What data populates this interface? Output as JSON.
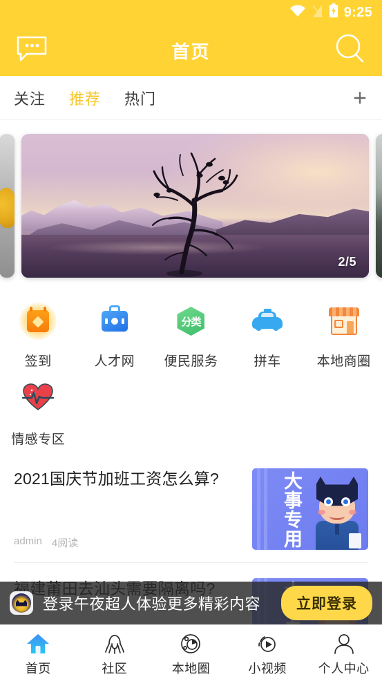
{
  "theme": {
    "brand_yellow": "#FFD333",
    "tab_active": "#F6C62B",
    "login_btn": "#FFD84A",
    "nav_active": "#2A9BF0"
  },
  "statusbar": {
    "time": "9:25",
    "icons": [
      "wifi-icon",
      "signal-off-icon",
      "battery-charging-icon"
    ]
  },
  "header": {
    "title": "首页",
    "left_icon": "chat-bubble-icon",
    "right_icon": "search-icon"
  },
  "tabs": {
    "items": [
      {
        "label": "关注",
        "active": false
      },
      {
        "label": "推荐",
        "active": true
      },
      {
        "label": "热门",
        "active": false
      }
    ],
    "add_label": "+",
    "add_icon": "plus-icon"
  },
  "carousel": {
    "indicator": "2/5",
    "slides": [
      {
        "name": "slide-prev",
        "art": "gray-gold-statue"
      },
      {
        "name": "slide-current",
        "art": "purple-mountain-lake-tree"
      },
      {
        "name": "slide-next",
        "art": "gray-green-landscape"
      }
    ]
  },
  "quick_links": {
    "row1": [
      {
        "label": "签到",
        "icon": "sign-in-calendar-icon"
      },
      {
        "label": "人才网",
        "icon": "briefcase-icon"
      },
      {
        "label": "便民服务",
        "icon": "category-hexagon-icon",
        "icon_text": "分类"
      },
      {
        "label": "拼车",
        "icon": "car-icon"
      },
      {
        "label": "本地商圈",
        "icon": "shop-icon"
      }
    ],
    "row2": [
      {
        "label": "情感专区",
        "icon": "heartbeat-icon"
      }
    ]
  },
  "articles": [
    {
      "title": "2021国庆节加班工资怎么算?",
      "author": "admin",
      "views": "4阅读",
      "thumb": {
        "overlay_text": "大事专用",
        "art": "blue-superhero-thumbnail"
      }
    },
    {
      "title": "福建莆田去汕头需要隔离吗?",
      "author": "",
      "views": "",
      "thumb": {
        "overlay_text": "大事专用",
        "art": "blue-superhero-thumbnail"
      }
    }
  ],
  "login_banner": {
    "text": "登录午夜超人体验更多精彩内容",
    "button_label": "立即登录",
    "avatar_icon": "app-logo-icon"
  },
  "bottom_nav": {
    "items": [
      {
        "label": "首页",
        "icon": "home-icon",
        "active": true
      },
      {
        "label": "社区",
        "icon": "community-icon",
        "active": false
      },
      {
        "label": "本地圈",
        "icon": "local-circle-icon",
        "active": false
      },
      {
        "label": "小视频",
        "icon": "play-video-icon",
        "active": false
      },
      {
        "label": "个人中心",
        "icon": "user-profile-icon",
        "active": false
      }
    ]
  }
}
